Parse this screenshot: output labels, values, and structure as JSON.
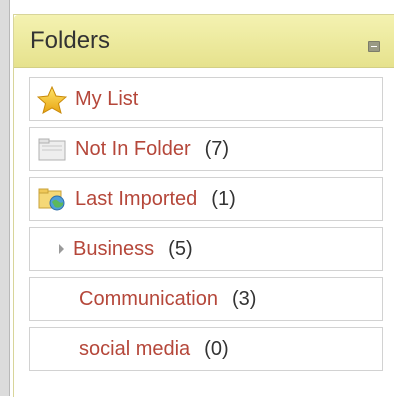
{
  "panel": {
    "title": "Folders"
  },
  "folders": [
    {
      "label": "My List",
      "count": "",
      "icon": "star-icon"
    },
    {
      "label": "Not In Folder",
      "count": "(7)",
      "icon": "folder-icon"
    },
    {
      "label": "Last Imported",
      "count": "(1)",
      "icon": "import-folder-icon"
    },
    {
      "label": "Business",
      "count": "(5)",
      "icon": "expand-arrow-icon"
    },
    {
      "label": "Communication",
      "count": "(3)",
      "icon": ""
    },
    {
      "label": "social media",
      "count": "(0)",
      "icon": ""
    }
  ],
  "colors": {
    "header": "#ece89a",
    "link": "#b5473a",
    "count": "#333333"
  }
}
